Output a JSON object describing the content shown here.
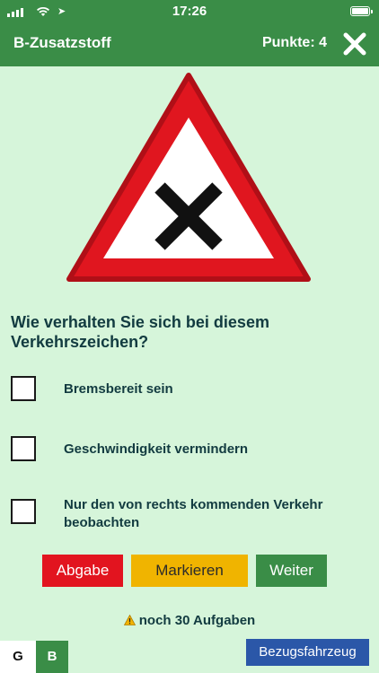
{
  "status_bar": {
    "time": "17:26"
  },
  "header": {
    "title": "B-Zusatzstoff",
    "score_label": "Punkte: 4"
  },
  "question": {
    "text": "Wie verhalten Sie sich bei diesem Verkehrszeichen?",
    "sign_icon": "intersection-warning-sign"
  },
  "answers": [
    {
      "label": "Bremsbereit sein",
      "checked": false
    },
    {
      "label": "Geschwindigkeit vermindern",
      "checked": false
    },
    {
      "label": "Nur den von rechts kommenden Verkehr beobachten",
      "checked": false
    }
  ],
  "actions": {
    "submit_label": "Abgabe",
    "mark_label": "Markieren",
    "next_label": "Weiter"
  },
  "remaining": {
    "text": "noch 30 Aufgaben"
  },
  "footer": {
    "tab_g": "G",
    "tab_b": "B",
    "vehicle_label": "Bezugsfahrzeug"
  },
  "colors": {
    "header_green": "#3a8d47",
    "background": "#d6f5da",
    "submit_red": "#e2141f",
    "mark_yellow": "#f0b400",
    "vehicle_blue": "#2b57a8"
  }
}
